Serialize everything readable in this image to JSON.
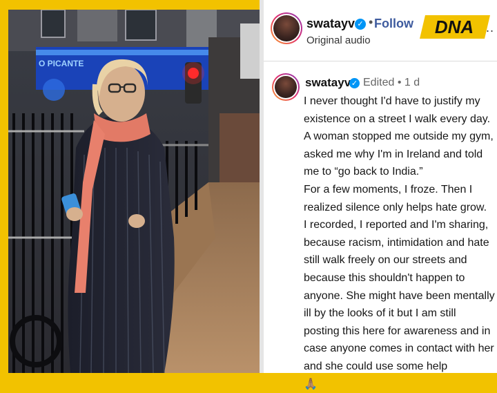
{
  "post": {
    "username": "swatayva",
    "follow_label": "Follow",
    "audio_label": "Original audio",
    "edited_label": "Edited",
    "time_label": "1 d",
    "brand_logo": "DNA",
    "more_icon": "more-horizontal-icon",
    "caption_lines": [
      "I never thought I'd have to justify my",
      "existence on a street I walk every day.",
      "A woman stopped me outside my gym,",
      "asked me why I'm in Ireland and told",
      "me to “go back to India.”",
      "For a few moments, I froze. Then I",
      "realized silence only helps hate grow.",
      "I recorded, I reported and I'm sharing,",
      "because racism, intimidation and hate",
      "still walk freely on our streets and",
      "because this shouldn't happen to",
      "anyone. She might have been mentally",
      "ill by the looks of it but I am still",
      "posting this here for awareness and in",
      "case anyone comes in contact with her",
      "and she could use some help"
    ],
    "caption_emoji": "🙏🏽"
  },
  "photo": {
    "shop_sign": "O PICANTE"
  },
  "colors": {
    "frame": "#f2c200",
    "follow": "#3e5b9e",
    "verified": "#0095f6"
  }
}
